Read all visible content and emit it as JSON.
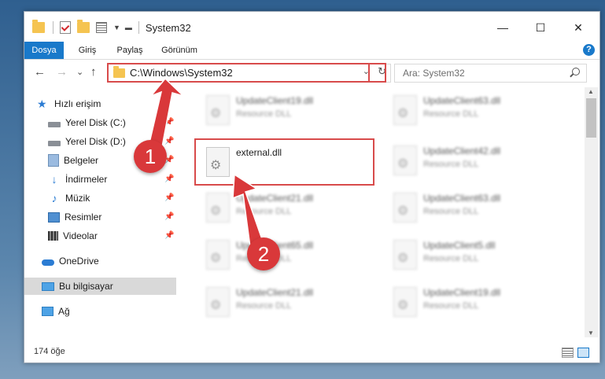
{
  "window": {
    "title": "System32",
    "buttons": {
      "minimize": "—",
      "maximize": "☐",
      "close": "✕"
    }
  },
  "ribbon": {
    "tabs": [
      "Dosya",
      "Giriş",
      "Paylaş",
      "Görünüm"
    ],
    "help": "?"
  },
  "address": {
    "path": "C:\\Windows\\System32",
    "dropdown": "⌄",
    "refresh": "↻"
  },
  "nav_buttons": {
    "back": "←",
    "forward": "→",
    "recent": "⌄",
    "up": "↑"
  },
  "search": {
    "placeholder": "Ara: System32"
  },
  "nav_pane": [
    {
      "label": "Hızlı erişim",
      "icon": "star-icon"
    },
    {
      "label": "Yerel Disk (C:)",
      "icon": "disk-icon",
      "pinned": true
    },
    {
      "label": "Yerel Disk (D:)",
      "icon": "disk-icon",
      "pinned": true
    },
    {
      "label": "Belgeler",
      "icon": "documents-icon",
      "pinned": true
    },
    {
      "label": "İndirmeler",
      "icon": "downloads-icon",
      "pinned": true
    },
    {
      "label": "Müzik",
      "icon": "music-icon",
      "pinned": true
    },
    {
      "label": "Resimler",
      "icon": "pictures-icon",
      "pinned": true
    },
    {
      "label": "Videolar",
      "icon": "videos-icon",
      "pinned": true
    },
    {
      "label": "OneDrive",
      "icon": "cloud-icon"
    },
    {
      "label": "Bu bilgisayar",
      "icon": "computer-icon",
      "selected": true
    },
    {
      "label": "Ağ",
      "icon": "network-icon"
    }
  ],
  "files": {
    "selected": {
      "name": "external.dll",
      "type": ""
    },
    "left_column": [
      {
        "name": "UpdateClient19.dll",
        "type": "Resource DLL"
      },
      {
        "name": "UpdateClient21.dll",
        "type": "Resource DLL"
      },
      {
        "name": "UpdateClient65.dll",
        "type": "Resource DLL"
      },
      {
        "name": "UpdateClient21.dll",
        "type": "Resource DLL"
      }
    ],
    "right_column": [
      {
        "name": "UpdateClient63.dll",
        "type": "Resource DLL"
      },
      {
        "name": "UpdateClient42.dll",
        "type": "Resource DLL"
      },
      {
        "name": "UpdateClient63.dll",
        "type": "Resource DLL"
      },
      {
        "name": "UpdateClient5.dll",
        "type": "Resource DLL"
      },
      {
        "name": "UpdateClient19.dll",
        "type": "Resource DLL"
      }
    ]
  },
  "status": {
    "count": "174 öğe"
  },
  "annotations": {
    "badge1": "1",
    "badge2": "2",
    "color": "#d9383a"
  }
}
